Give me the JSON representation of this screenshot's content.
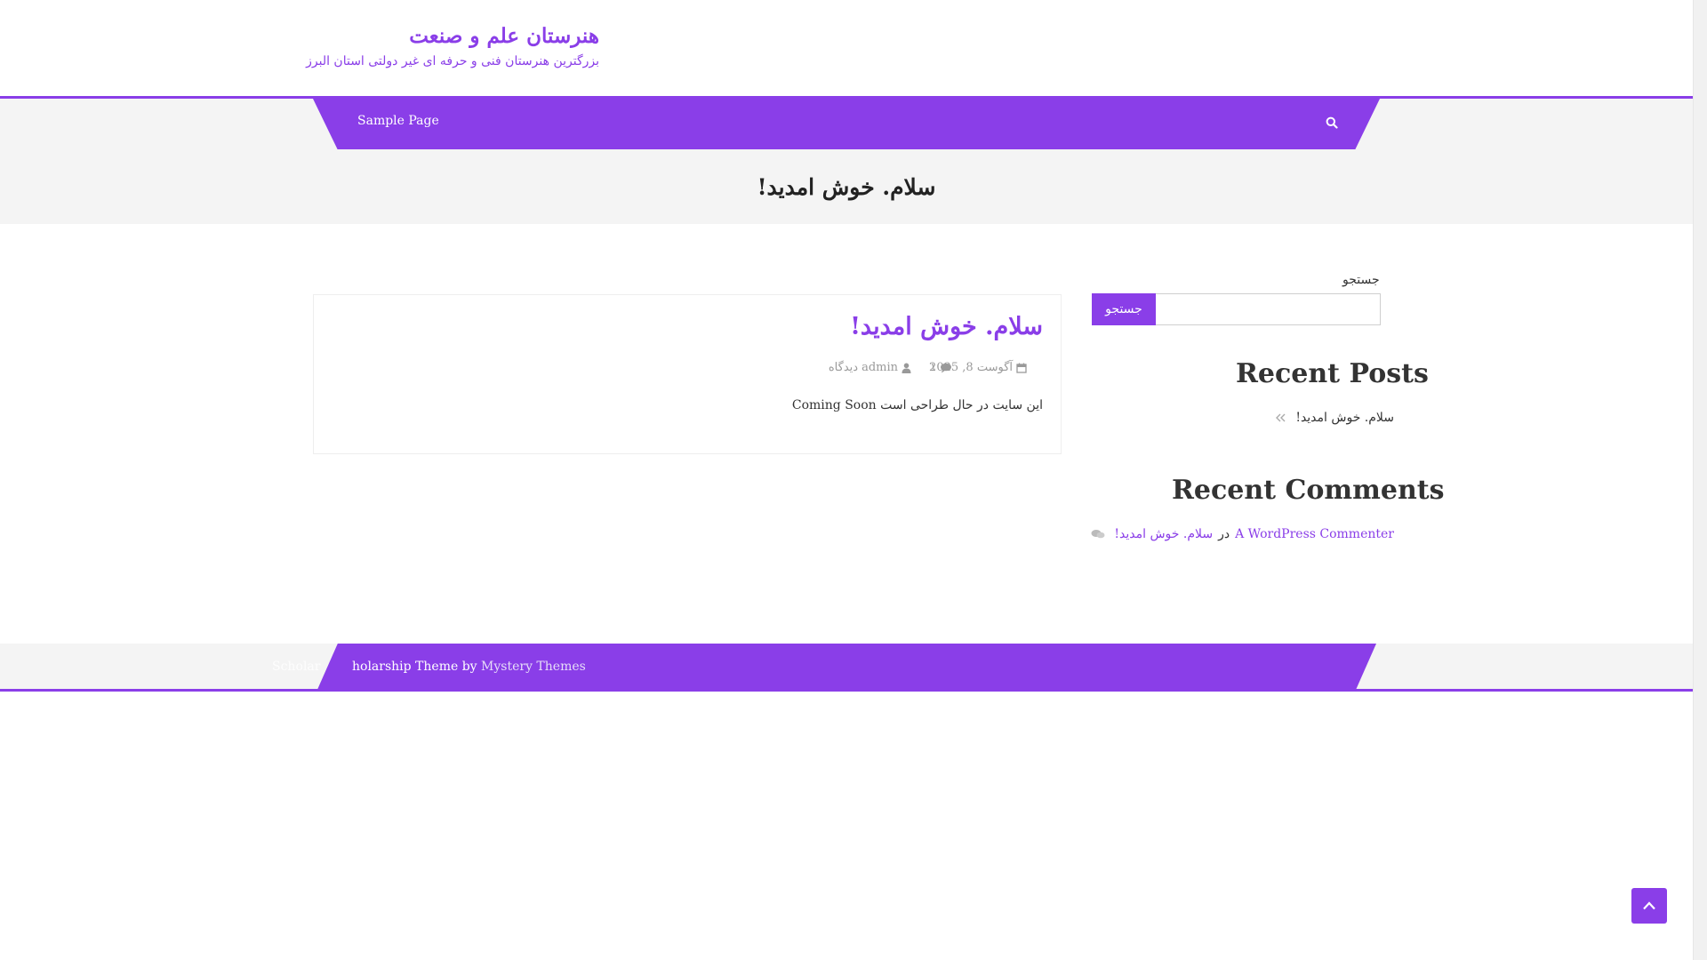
{
  "colors": {
    "accent": "#8a3ee8",
    "band": "#f4f4f4",
    "text": "#333333"
  },
  "header": {
    "site_title": "هنرستان علم و صنعت",
    "site_description": "بزرگترین هنرستان فنی و حرفه ای غیر دولتی استان البرز"
  },
  "nav": {
    "items": [
      {
        "label": "Sample Page"
      }
    ],
    "search_icon": "search-icon"
  },
  "page": {
    "title": "سلام. خوش امدید!"
  },
  "article": {
    "title": "سلام. خوش امدید!",
    "date": "آگوست 8, 2025",
    "comments": "۱",
    "author": "admin",
    "views": "دیدگاه",
    "excerpt": "این سایت در حال طراحی است Coming Soon"
  },
  "sidebar": {
    "search_label": "جستجو",
    "search_placeholder": "",
    "search_button": "جستجو",
    "recent_posts_title": "Recent Posts",
    "recent_posts": [
      {
        "label": "سلام. خوش امدید!"
      }
    ],
    "recent_comments_title": "Recent Comments",
    "recent_comments": [
      {
        "author": "A WordPress Commenter",
        "connector": "در",
        "post": "سلام. خوش امدید!"
      }
    ]
  },
  "footer": {
    "faded_text": "Scholar",
    "credit_prefix": "holarship Theme by",
    "credit_link": "Mystery Themes"
  },
  "back_to_top_icon": "chevron-up-icon"
}
